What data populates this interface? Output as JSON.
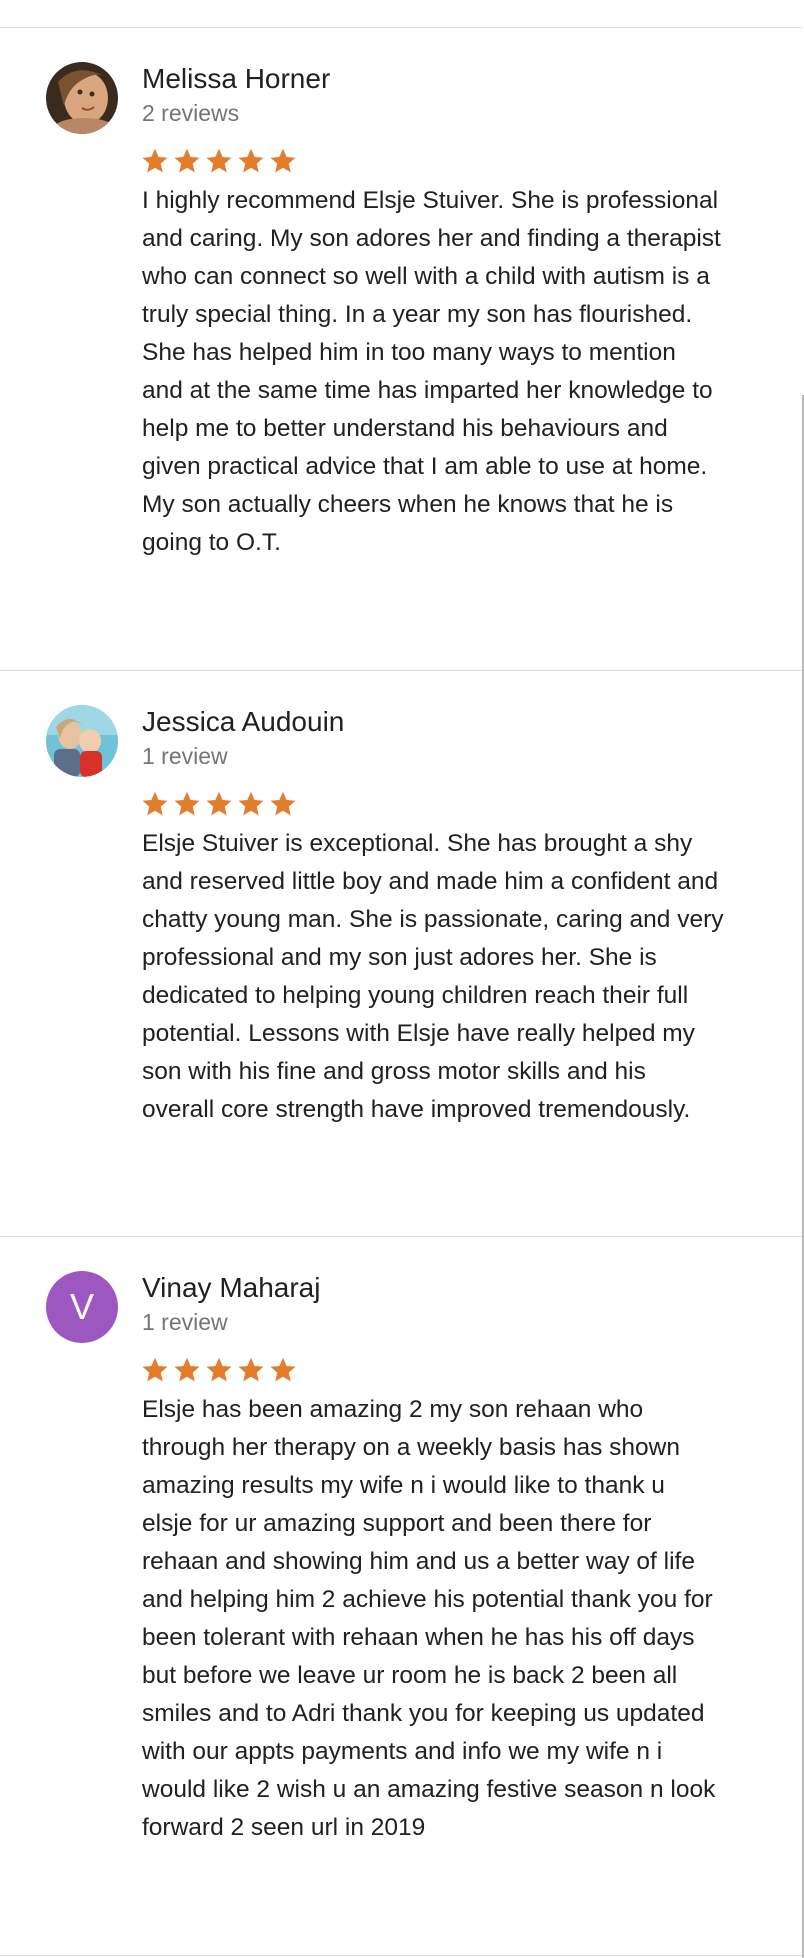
{
  "reviews": [
    {
      "name": "Melissa Horner",
      "count": "2 reviews",
      "rating": 5,
      "avatar": "photo",
      "text": "I highly recommend Elsje Stuiver. She is professional\nand caring. My son adores her and finding a therapist\nwho can connect so well with a child with autism is a\ntruly special thing. In a year my son has flourished.\nShe has helped him in too many ways to mention\nand at the same time has imparted her knowledge to\nhelp me to better understand his behaviours and\ngiven practical advice that I am able to use at home.\nMy son actually cheers when he knows that he is\ngoing to O.T."
    },
    {
      "name": "Jessica Audouin",
      "count": "1 review",
      "rating": 5,
      "avatar": "photo",
      "text": "Elsje Stuiver is exceptional. She has brought a shy\nand reserved little boy and made him a confident and\nchatty young man. She is passionate, caring and very\nprofessional and my son just adores her. She is\ndedicated to helping young children reach their full\npotential. Lessons with Elsje have really helped my\nson with his fine and gross motor skills and his\noverall core strength have improved tremendously."
    },
    {
      "name": "Vinay Maharaj",
      "count": "1 review",
      "rating": 5,
      "avatar": "V",
      "text": "Elsje has been amazing 2 my son rehaan who\nthrough her therapy on a weekly basis has shown\namazing results my wife n i would like to thank u\nelsje for ur amazing support and been there for\nrehaan and showing him and us a better way of life\nand helping him 2 achieve his potential thank you for\nbeen tolerant with rehaan when he has his off days\nbut before we leave ur room he is back 2 been all\nsmiles and to Adri thank you for keeping us updated\nwith our appts payments and info we my wife n i\nwould like 2 wish u an amazing festive season n look\nforward 2 seen url in 2019"
    }
  ],
  "colors": {
    "star": "#e37c2b",
    "avatar_letter_bg": "#9c57c0"
  },
  "icons": {
    "star": "star-icon"
  }
}
